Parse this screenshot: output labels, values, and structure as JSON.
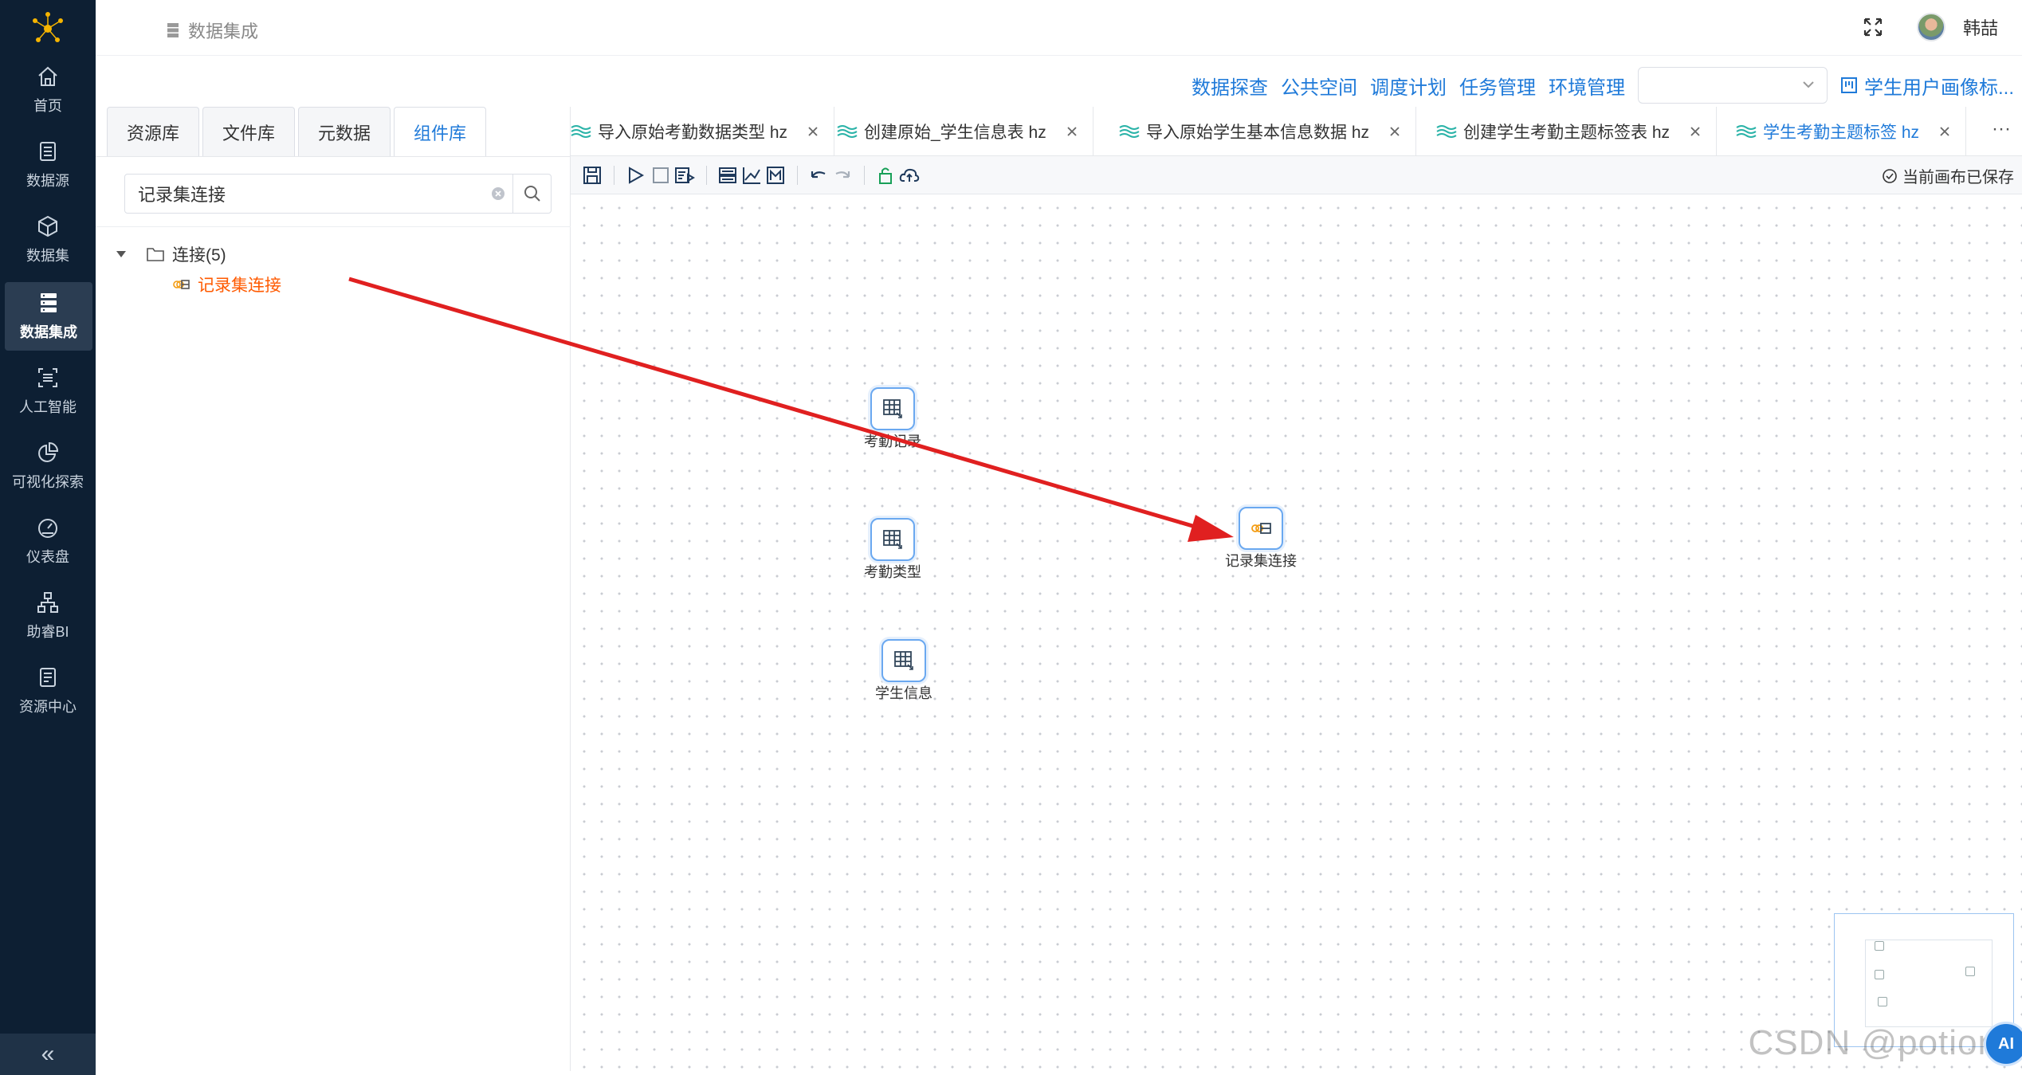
{
  "nav": {
    "items": [
      {
        "label": "首页",
        "icon": "home-icon"
      },
      {
        "label": "数据源",
        "icon": "datasource-icon"
      },
      {
        "label": "数据集",
        "icon": "dataset-icon"
      },
      {
        "label": "数据集成",
        "icon": "integration-icon",
        "active": true
      },
      {
        "label": "人工智能",
        "icon": "ai-icon"
      },
      {
        "label": "可视化探索",
        "icon": "pie-icon"
      },
      {
        "label": "仪表盘",
        "icon": "gauge-icon"
      },
      {
        "label": "助睿BI",
        "icon": "org-chart-icon"
      },
      {
        "label": "资源中心",
        "icon": "document-icon"
      }
    ],
    "collapse": "«"
  },
  "header": {
    "breadcrumb": "数据集成",
    "user_name": "韩喆"
  },
  "top_menu": {
    "links": [
      "数据探查",
      "公共空间",
      "调度计划",
      "任务管理",
      "环境管理"
    ],
    "select_value": "",
    "project": "学生用户画像标..."
  },
  "left_panel": {
    "tabs": [
      "资源库",
      "文件库",
      "元数据",
      "组件库"
    ],
    "active_tab": "组件库",
    "search_value": "记录集连接",
    "tree": {
      "folder": "连接(5)",
      "leaf": "记录集连接"
    }
  },
  "editor_tabs": [
    {
      "label": "导入原始考勤数据类型 hz"
    },
    {
      "label": "创建原始_学生信息表 hz"
    },
    {
      "label": "导入原始学生基本信息数据 hz"
    },
    {
      "label": "创建学生考勤主题标签表 hz"
    },
    {
      "label": "学生考勤主题标签 hz",
      "active": true
    }
  ],
  "editor_more": "···",
  "toolbar": {
    "status": "当前画布已保存"
  },
  "canvas": {
    "nodes": [
      {
        "label": "考勤记录"
      },
      {
        "label": "考勤类型"
      },
      {
        "label": "学生信息"
      },
      {
        "label": "记录集连接"
      }
    ]
  },
  "watermark": "CSDN @potion",
  "ai_badge": "AI",
  "colors": {
    "nav_bg": "#0d1f33",
    "accent": "#1f7ad9",
    "leaf_orange": "#ff5a00",
    "arrow_red": "#e02020"
  }
}
